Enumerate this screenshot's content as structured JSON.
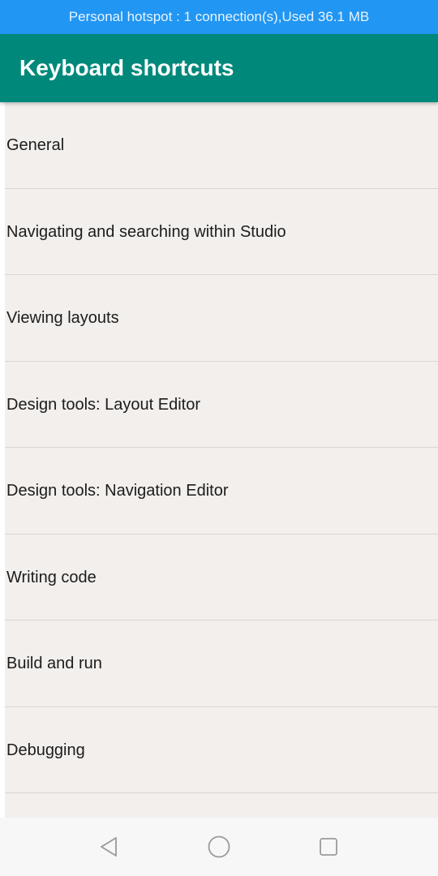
{
  "status_bar": {
    "text": "Personal hotspot : 1 connection(s),Used  36.1 MB"
  },
  "app_bar": {
    "title": "Keyboard shortcuts"
  },
  "shortcut_categories": [
    {
      "label": "General"
    },
    {
      "label": "Navigating and searching within Studio"
    },
    {
      "label": "Viewing layouts"
    },
    {
      "label": "Design tools: Layout Editor"
    },
    {
      "label": "Design tools: Navigation Editor"
    },
    {
      "label": "Writing code"
    },
    {
      "label": "Build and run"
    },
    {
      "label": "Debugging"
    }
  ],
  "navigation_bar": {
    "back_icon": "triangle-back-icon",
    "home_icon": "circle-home-icon",
    "recent_icon": "square-recents-icon"
  },
  "colors": {
    "status_bar": "#2196f3",
    "app_bar": "#00897b",
    "list_background": "#f2efed",
    "divider": "#dad6d3"
  }
}
